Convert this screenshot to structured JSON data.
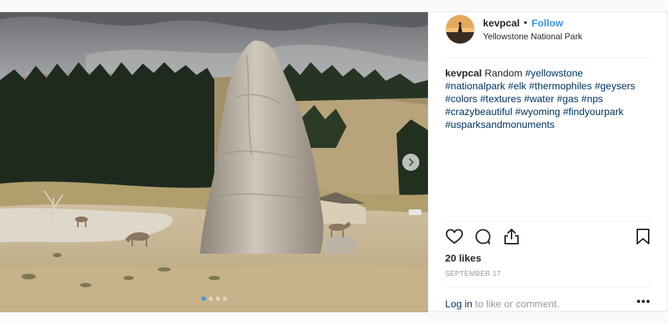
{
  "header": {
    "username": "kevpcal",
    "separator": "•",
    "follow_label": "Follow",
    "location": "Yellowstone National Park"
  },
  "caption": {
    "username": "kevpcal",
    "text": "Random",
    "lines": [
      "#yellowstone",
      "#nationalpark #elk #thermophiles #geysers",
      "#colors #textures #water #gas #nps",
      "#crazybeautiful #wyoming #findyourpark",
      "#usparksandmonuments"
    ]
  },
  "actions": {
    "like_icon": "heart-icon",
    "comment_icon": "comment-icon",
    "share_icon": "share-icon",
    "save_icon": "bookmark-icon"
  },
  "stats": {
    "likes": "20 likes",
    "date": "September 17"
  },
  "footer": {
    "login_link": "Log in",
    "login_rest": " to like or comment.",
    "more": "•••"
  },
  "carousel": {
    "slide_count": 4,
    "active_index": 0,
    "next_icon": "chevron-right-icon"
  },
  "colors": {
    "accent": "#3897f0",
    "link": "#003569",
    "muted": "#999999"
  }
}
